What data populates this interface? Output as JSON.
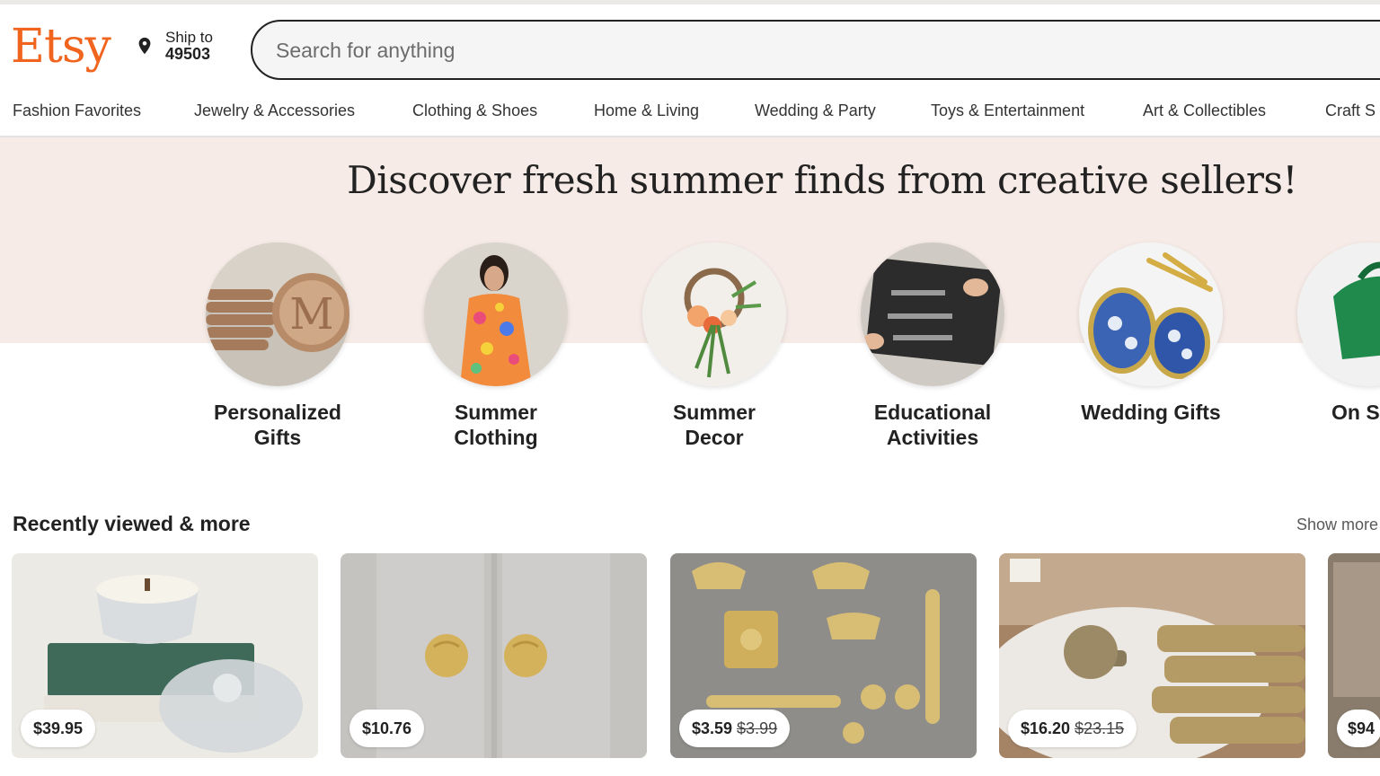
{
  "header": {
    "logo": "Etsy",
    "ship_label": "Ship to",
    "ship_zip": "49503",
    "search_placeholder": "Search for anything"
  },
  "nav": {
    "items": [
      "Fashion Favorites",
      "Jewelry & Accessories",
      "Clothing & Shoes",
      "Home & Living",
      "Wedding & Party",
      "Toys & Entertainment",
      "Art & Collectibles",
      "Craft S"
    ]
  },
  "hero": {
    "title": "Discover fresh summer finds from creative sellers!",
    "categories": [
      {
        "line1": "Personalized",
        "line2": "Gifts"
      },
      {
        "line1": "Summer",
        "line2": "Clothing"
      },
      {
        "line1": "Summer",
        "line2": "Decor"
      },
      {
        "line1": "Educational",
        "line2": "Activities"
      },
      {
        "line1": "Wedding Gifts",
        "line2": ""
      },
      {
        "line1": "On S",
        "line2": ""
      }
    ]
  },
  "recent": {
    "title": "Recently viewed & more",
    "show_more": "Show more",
    "items": [
      {
        "price": "$39.95",
        "original": ""
      },
      {
        "price": "$10.76",
        "original": ""
      },
      {
        "price": "$3.59",
        "original": "$3.99"
      },
      {
        "price": "$16.20",
        "original": "$23.15"
      },
      {
        "price": "$94",
        "original": ""
      }
    ]
  },
  "colors": {
    "brand": "#f1641e",
    "hero_band": "#f6ebe6",
    "text": "#222222"
  },
  "icons": {
    "location": "location-pin-icon"
  }
}
